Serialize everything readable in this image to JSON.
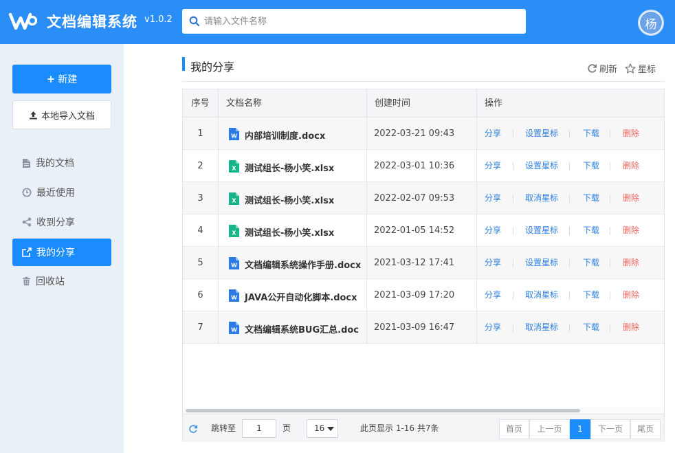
{
  "header": {
    "app_title": "文档编辑系统",
    "version": "v1.0.2",
    "search_placeholder": "请输入文件名称",
    "avatar_text": "杨",
    "brand_color": "#2b8ef7"
  },
  "sidebar": {
    "new_button": "新建",
    "import_button": "本地导入文档",
    "items": [
      {
        "label": "我的文档",
        "icon": "document-icon"
      },
      {
        "label": "最近使用",
        "icon": "clock-icon"
      },
      {
        "label": "收到分享",
        "icon": "share-nodes-icon"
      },
      {
        "label": "我的分享",
        "icon": "share-out-icon",
        "active": true
      },
      {
        "label": "回收站",
        "icon": "trash-icon"
      }
    ]
  },
  "main": {
    "title": "我的分享",
    "refresh_label": "刷新",
    "star_label": "星标",
    "columns": [
      "序号",
      "文档名称",
      "创建时间",
      "操作"
    ],
    "rows": [
      {
        "index": "1",
        "name": "内部培训制度.docx",
        "type": "word",
        "created": "2022-03-21 09:43",
        "actions": [
          "分享",
          "设置星标",
          "下载",
          "删除"
        ]
      },
      {
        "index": "2",
        "name": "测试组长-杨小笑.xlsx",
        "type": "excel",
        "created": "2022-03-01 10:36",
        "actions": [
          "分享",
          "设置星标",
          "下载",
          "删除"
        ]
      },
      {
        "index": "3",
        "name": "测试组长-杨小笑.xlsx",
        "type": "excel",
        "created": "2022-02-07 09:53",
        "actions": [
          "分享",
          "取消星标",
          "下载",
          "删除"
        ]
      },
      {
        "index": "4",
        "name": "测试组长-杨小笑.xlsx",
        "type": "excel",
        "created": "2022-01-05 14:52",
        "actions": [
          "分享",
          "设置星标",
          "下载",
          "删除"
        ]
      },
      {
        "index": "5",
        "name": "文档编辑系统操作手册.docx",
        "type": "word",
        "created": "2021-03-12 17:41",
        "actions": [
          "分享",
          "设置星标",
          "下载",
          "删除"
        ]
      },
      {
        "index": "6",
        "name": "JAVA公开自动化脚本.docx",
        "type": "word",
        "created": "2021-03-09 17:20",
        "actions": [
          "分享",
          "取消星标",
          "下载",
          "删除"
        ]
      },
      {
        "index": "7",
        "name": "文档编辑系统BUG汇总.doc",
        "type": "word",
        "created": "2021-03-09 16:47",
        "actions": [
          "分享",
          "取消星标",
          "下载",
          "删除"
        ]
      }
    ]
  },
  "pagination": {
    "jump_label": "跳转至",
    "jump_value": "1",
    "page_unit": "页",
    "page_size": "16",
    "summary": "此页显示 1-16 共7条",
    "first": "首页",
    "prev": "上一页",
    "current": "1",
    "next": "下一页",
    "last": "尾页"
  }
}
